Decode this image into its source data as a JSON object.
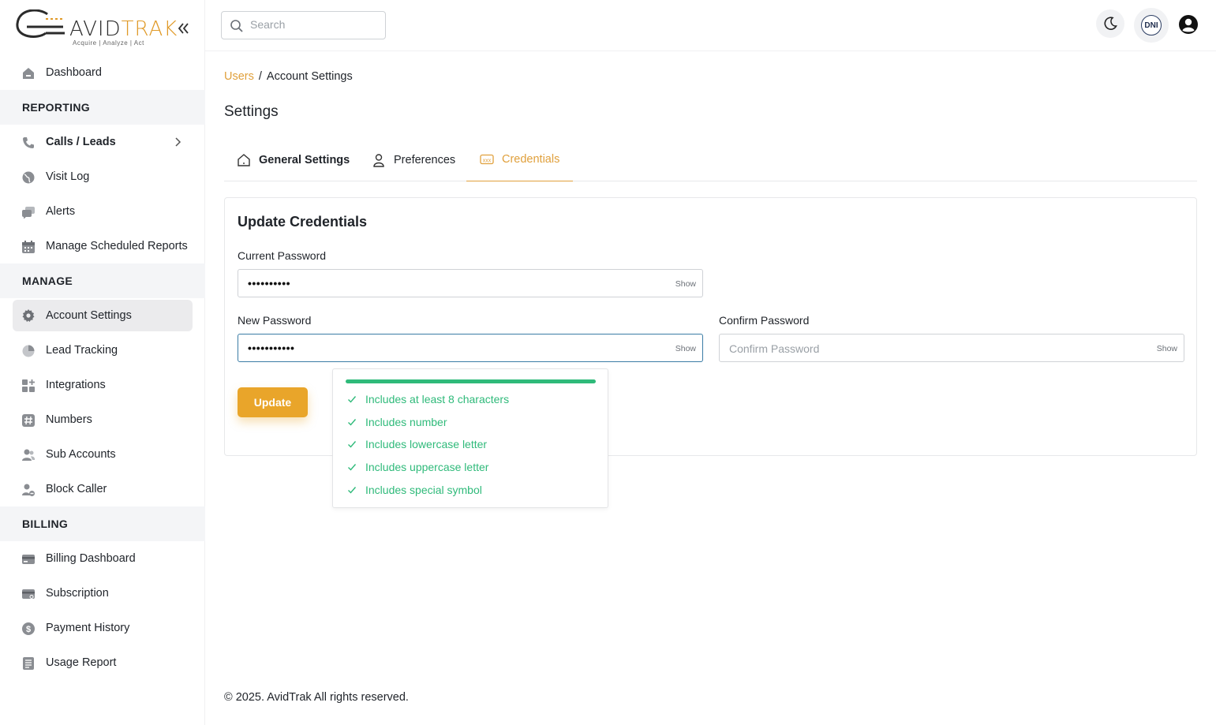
{
  "brand": {
    "name_part1": "AVID",
    "name_part2": "TRAK",
    "tagline": "Acquire  |  Analyze  |  Act"
  },
  "sidebar": {
    "items": [
      {
        "label": "Dashboard",
        "icon": "home-icon"
      },
      {
        "section": "REPORTING"
      },
      {
        "label": "Calls / Leads",
        "icon": "phone-icon"
      },
      {
        "label": "Visit Log",
        "icon": "globe-icon"
      },
      {
        "label": "Alerts",
        "icon": "chat-icon"
      },
      {
        "label": "Manage Scheduled Reports",
        "icon": "calendar-icon"
      },
      {
        "section": "MANAGE"
      },
      {
        "label": "Account Settings",
        "icon": "gear-icon"
      },
      {
        "label": "Lead Tracking",
        "icon": "pie-chart-icon"
      },
      {
        "label": "Integrations",
        "icon": "grid-plus-icon"
      },
      {
        "label": "Numbers",
        "icon": "hash-icon"
      },
      {
        "label": "Sub Accounts",
        "icon": "users-icon"
      },
      {
        "label": "Block Caller",
        "icon": "user-block-icon"
      },
      {
        "section": "BILLING"
      },
      {
        "label": "Billing Dashboard",
        "icon": "credit-card-icon"
      },
      {
        "label": "Subscription",
        "icon": "card-refresh-icon"
      },
      {
        "label": "Payment History",
        "icon": "dollar-circle-icon"
      },
      {
        "label": "Usage Report",
        "icon": "report-icon"
      }
    ]
  },
  "header": {
    "search_placeholder": "Search",
    "dni_label": "DNI"
  },
  "breadcrumb": {
    "parent": "Users",
    "separator": "/",
    "current": "Account Settings"
  },
  "page_title": "Settings",
  "tabs": [
    {
      "label": "General Settings",
      "icon": "house-icon"
    },
    {
      "label": "Preferences",
      "icon": "person-icon"
    },
    {
      "label": "Credentials",
      "icon": "password-icon"
    }
  ],
  "credentials": {
    "title": "Update Credentials",
    "current_password": {
      "label": "Current Password",
      "value": "••••••••••",
      "toggle": "Show"
    },
    "new_password": {
      "label": "New Password",
      "value": "•••••••••••",
      "toggle": "Show"
    },
    "confirm_password": {
      "label": "Confirm Password",
      "placeholder": "Confirm Password",
      "toggle": "Show"
    },
    "update_label": "Update",
    "strength_fraction": 1.0,
    "rules": [
      "Includes at least 8 characters",
      "Includes number",
      "Includes lowercase letter",
      "Includes uppercase letter",
      "Includes special symbol"
    ]
  },
  "colors": {
    "accent": "#e0a03c",
    "button": "#e9a52a",
    "success": "#2fba7a"
  },
  "footer": "© 2025. AvidTrak All rights reserved."
}
